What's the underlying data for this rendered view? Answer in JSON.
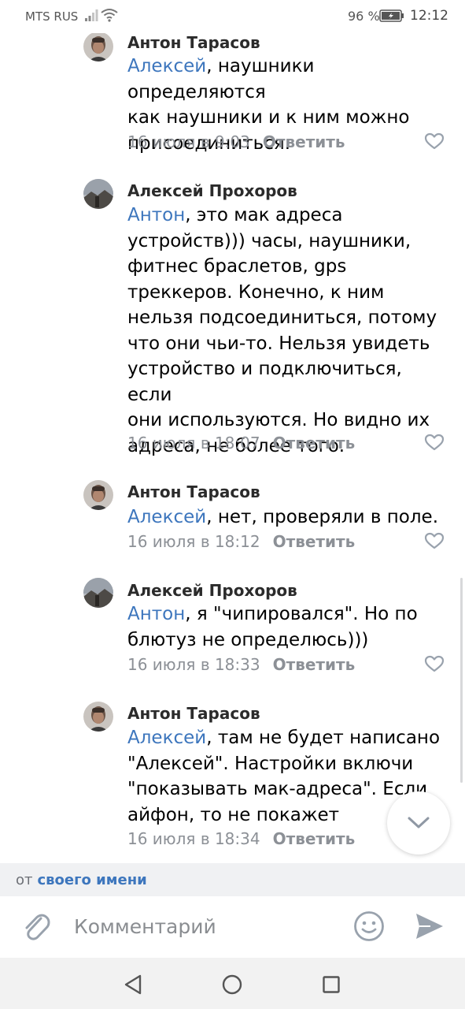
{
  "status_bar": {
    "carrier": "MTS RUS",
    "battery": "96 %",
    "time": "12:12"
  },
  "comments": [
    {
      "author": "Антон Тарасов",
      "mention": "Алексей",
      "lines": [
        ", наушники определяются",
        "как наушники и к ним можно",
        "присоединиться."
      ],
      "date": "16 июля в 9:03",
      "reply": "Ответить"
    },
    {
      "author": "Алексей Прохоров",
      "mention": "Антон",
      "lines": [
        ", это мак адреса",
        "устройств))) часы, наушники,",
        "фитнес браслетов, gps",
        "треккеров. Конечно, к ним",
        "нельзя подсоединиться, потому",
        "что они чьи-то. Нельзя увидеть",
        "устройство и подключиться, если",
        "они используются. Но видно их",
        "адреса, не более того."
      ],
      "date": "16 июля в 18:07",
      "reply": "Ответить"
    },
    {
      "author": "Антон Тарасов",
      "mention": "Алексей",
      "lines": [
        ", нет, проверяли в поле."
      ],
      "date": "16 июля в 18:12",
      "reply": "Ответить"
    },
    {
      "author": "Алексей Прохоров",
      "mention": "Антон",
      "lines": [
        ", я \"чипировался\".  Но по",
        "блютуз не определюсь)))"
      ],
      "date": "16 июля в 18:33",
      "reply": "Ответить"
    },
    {
      "author": "Антон Тарасов",
      "mention": "Алексей",
      "lines": [
        ", там не будет написано",
        "\"Алексей\". Настройки включи",
        "\"показывать мак-адреса\". Если",
        "айфон, то не покажет"
      ],
      "date": "16 июля в 18:34",
      "reply": "Ответить"
    }
  ],
  "from_bar": {
    "prefix": "от",
    "link": "своего имени"
  },
  "composer": {
    "placeholder": "Комментарий"
  },
  "icons": {
    "attach": "paperclip-icon",
    "emoji": "smiley-icon",
    "send": "send-icon",
    "like": "heart-icon",
    "scroll_down": "chevron-down-icon",
    "nav_back": "triangle-back-icon",
    "nav_home": "circle-home-icon",
    "nav_recent": "square-recent-icon"
  },
  "colors": {
    "link": "#3d76bd",
    "meta": "#8c9096",
    "icon": "#99a2ad"
  }
}
